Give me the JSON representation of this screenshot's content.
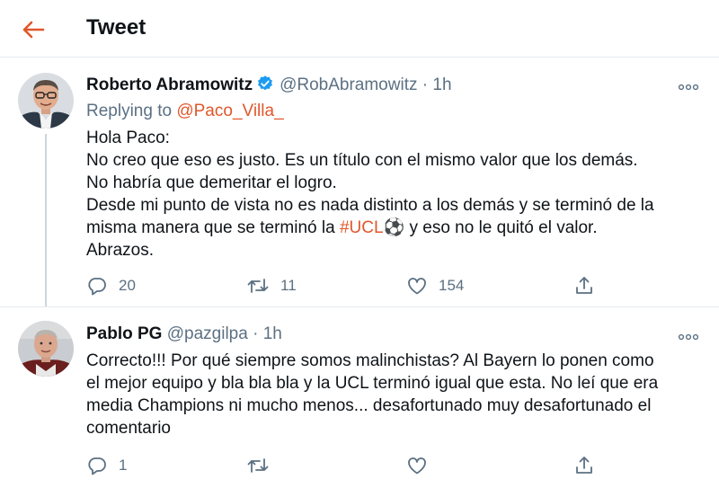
{
  "header": {
    "title": "Tweet",
    "back_icon": "back-arrow-icon"
  },
  "accent_color": "#e0572b",
  "tweets": [
    {
      "name": "Roberto Abramowitz",
      "verified": true,
      "handle": "@RobAbramowitz",
      "dot": "·",
      "time": "1h",
      "replying_label": "Replying to",
      "replying_to": "@Paco_Villa_",
      "lines": [
        "Hola Paco:",
        "No creo que eso es justo. Es un título con el mismo valor que los demás.",
        "No habría que demeritar el logro.",
        "Desde mi punto de vista no es nada distinto a los demás y se terminó de la",
        "misma manera que se terminó la "
      ],
      "hashtag": "#UCL",
      "emoji": "⚽",
      "line_after_hashtag": " y eso no le quitó el valor.",
      "last_line": "Abrazos.",
      "replies": "20",
      "retweets": "11",
      "likes": "154"
    },
    {
      "name": "Pablo PG",
      "handle": "@pazgilpa",
      "dot": "·",
      "time": "1h",
      "lines": [
        "Correcto!!! Por qué siempre somos malinchistas? Al Bayern lo ponen como",
        "el mejor equipo y bla bla bla y la UCL terminó igual que esta. No leí que era",
        "media Champions ni mucho menos... desafortunado muy desafortunado el",
        "comentario"
      ],
      "replies": "1",
      "retweets": "",
      "likes": ""
    }
  ]
}
